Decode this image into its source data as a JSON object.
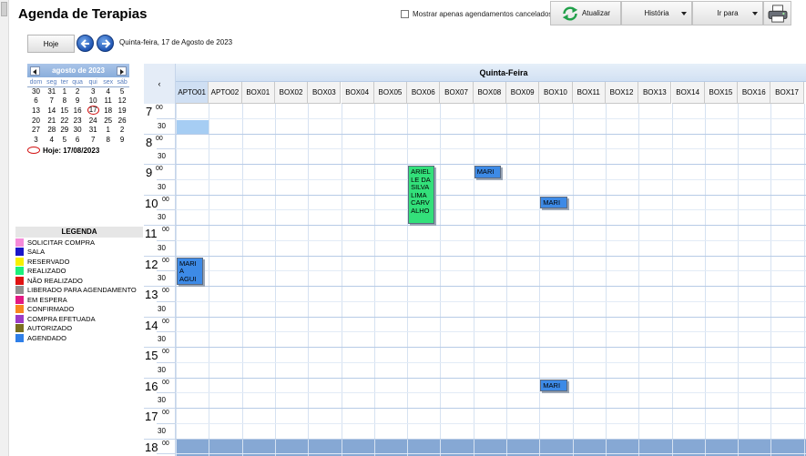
{
  "app": {
    "title": "Agenda de Terapias"
  },
  "toolbar": {
    "cancel_filter_label": "Mostrar apenas agendamentos cancelados",
    "refresh_label": "Atualizar",
    "history_label": "História",
    "goto_label": "Ir para"
  },
  "nav": {
    "today_label": "Hoje",
    "current_date": "Quinta-feira, 17 de Agosto de 2023"
  },
  "calendar": {
    "month_label": "agosto de 2023",
    "weekdays": [
      "dom",
      "seg",
      "ter",
      "qua",
      "qui",
      "sex",
      "sáb"
    ],
    "weeks": [
      [
        "30",
        "31",
        "1",
        "2",
        "3",
        "4",
        "5"
      ],
      [
        "6",
        "7",
        "8",
        "9",
        "10",
        "11",
        "12"
      ],
      [
        "13",
        "14",
        "15",
        "16",
        "17",
        "18",
        "19"
      ],
      [
        "20",
        "21",
        "22",
        "23",
        "24",
        "25",
        "26"
      ],
      [
        "27",
        "28",
        "29",
        "30",
        "31",
        "1",
        "2"
      ],
      [
        "3",
        "4",
        "5",
        "6",
        "7",
        "8",
        "9"
      ]
    ],
    "today_text": "Hoje: 17/08/2023"
  },
  "legend": {
    "title": "LEGENDA",
    "items": [
      {
        "label": "SOLICITAR COMPRA",
        "color": "#f58bd9"
      },
      {
        "label": "SALA",
        "color": "#1a16c8"
      },
      {
        "label": "RESERVADO",
        "color": "#f7f000"
      },
      {
        "label": "REALIZADO",
        "color": "#1df07c"
      },
      {
        "label": "NÃO REALIZADO",
        "color": "#e01313"
      },
      {
        "label": "LIBERADO PARA AGENDAMENTO",
        "color": "#909090"
      },
      {
        "label": "EM ESPERA",
        "color": "#e21a84"
      },
      {
        "label": "CONFIRMADO",
        "color": "#f7871e"
      },
      {
        "label": "COMPRA EFETUADA",
        "color": "#9c3ac6"
      },
      {
        "label": "AUTORIZADO",
        "color": "#7a6f1f"
      },
      {
        "label": "AGENDADO",
        "color": "#2f7fe8"
      }
    ]
  },
  "schedule": {
    "collapse_glyph": "‹",
    "day_title": "Quinta-Feira",
    "columns": [
      "APTO01",
      "APTO02",
      "BOX01",
      "BOX02",
      "BOX03",
      "BOX04",
      "BOX05",
      "BOX06",
      "BOX07",
      "BOX08",
      "BOX09",
      "BOX10",
      "BOX11",
      "BOX12",
      "BOX13",
      "BOX14",
      "BOX15",
      "BOX16",
      "BOX17"
    ],
    "hours": [
      {
        "hour": "7",
        "min": "00",
        "half": "30"
      },
      {
        "hour": "8",
        "min": "00",
        "half": "30"
      },
      {
        "hour": "9",
        "min": "00",
        "half": "30"
      },
      {
        "hour": "10",
        "min": "00",
        "half": "30"
      },
      {
        "hour": "11",
        "min": "00",
        "half": "30"
      },
      {
        "hour": "12",
        "min": "00",
        "half": "30"
      },
      {
        "hour": "13",
        "min": "00",
        "half": "30"
      },
      {
        "hour": "14",
        "min": "00",
        "half": "30"
      },
      {
        "hour": "15",
        "min": "00",
        "half": "30"
      },
      {
        "hour": "16",
        "min": "00",
        "half": "30"
      },
      {
        "hour": "17",
        "min": "00",
        "half": "30"
      },
      {
        "hour": "18",
        "min": "00",
        "half": ""
      }
    ],
    "appointments": [
      {
        "lines": [
          "ARIEL",
          "LE DA",
          "SILVA",
          "LIMA",
          "CARV",
          "ALHO"
        ],
        "column": 7,
        "start": 4,
        "slots": 4,
        "color": "#33e07a"
      },
      {
        "lines": [
          "MARI"
        ],
        "column": 9,
        "start": 4,
        "slots": 1,
        "color": "#3d8ae6"
      },
      {
        "lines": [
          "MARI"
        ],
        "column": 11,
        "start": 6,
        "slots": 1,
        "color": "#3d8ae6"
      },
      {
        "lines": [
          "MARI",
          "A",
          "AGUI"
        ],
        "column": 0,
        "start": 10,
        "slots": 2,
        "color": "#3d8ae6"
      },
      {
        "lines": [
          "MARI"
        ],
        "column": 11,
        "start": 18,
        "slots": 1,
        "color": "#3d8ae6"
      }
    ]
  }
}
